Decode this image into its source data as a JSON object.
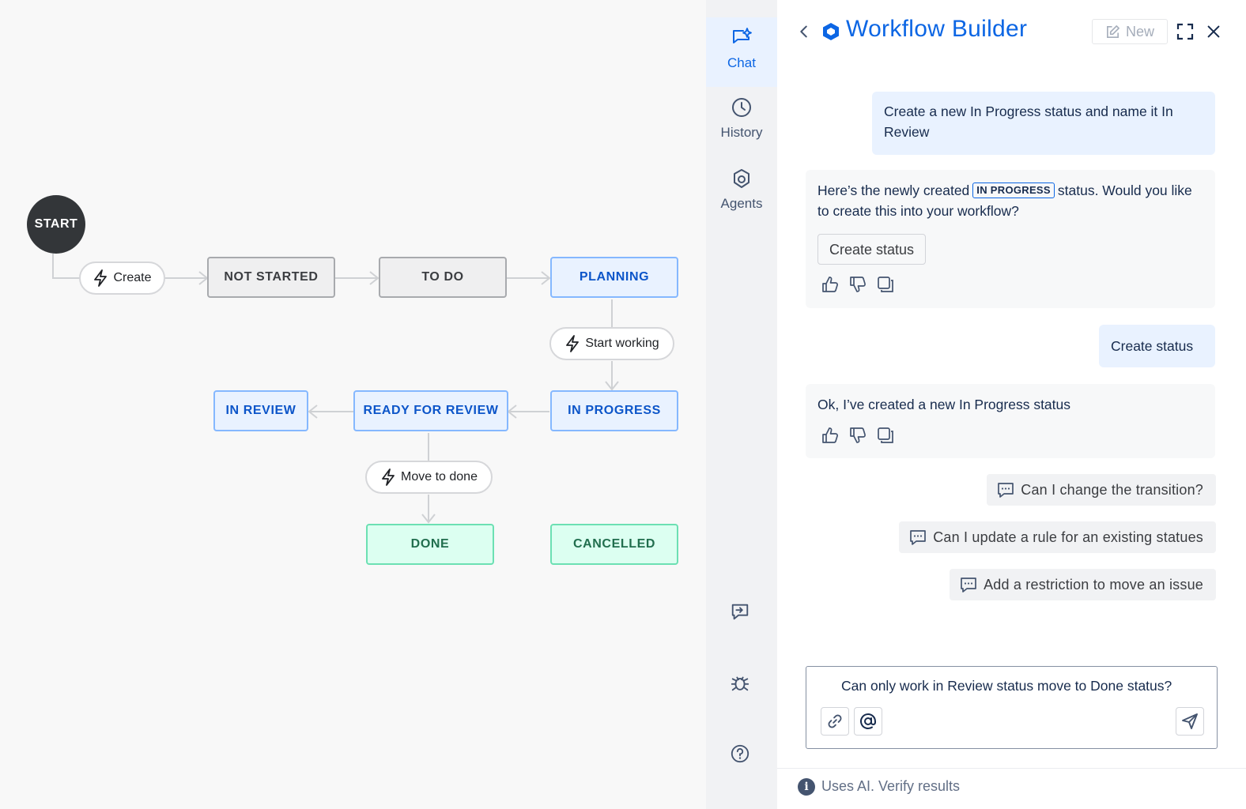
{
  "canvas": {
    "start_label": "START",
    "statuses": {
      "not_started": "NOT STARTED",
      "to_do": "TO DO",
      "planning": "PLANNING",
      "in_progress": "IN PROGRESS",
      "ready_for_review": "READY FOR REVIEW",
      "in_review": "IN REVIEW",
      "done": "DONE",
      "cancelled": "CANCELLED"
    },
    "transitions": {
      "create": "Create",
      "start_working": "Start working",
      "move_to_done": "Move to done"
    }
  },
  "rail": {
    "chat": "Chat",
    "history": "History",
    "agents": "Agents"
  },
  "header": {
    "title": "Workflow Builder",
    "new_label": "New"
  },
  "messages": {
    "user_1": "Create a new In Progress status and name it In Review",
    "ai_1_before": "Here’s the newly created",
    "ai_1_lozenge": "IN PROGRESS",
    "ai_1_after": "status. Would you like to create this into your workflow?",
    "ai_1_action": "Create status",
    "user_2": "Create status",
    "ai_2": "Ok, I’ve created a new In Progress status"
  },
  "suggestions": [
    "Can I change the transition?",
    "Can I update a rule for an existing statues",
    "Add a restriction to move an issue"
  ],
  "composer": {
    "value": "Can only work in Review status move to Done status?"
  },
  "footer": {
    "info_glyph": "i",
    "text": "Uses AI. Verify results"
  },
  "colors": {
    "accent": "#0c66e4",
    "status_blue_bg": "#e9f2ff",
    "status_green_bg": "#dcfff1",
    "start_node": "#333639"
  }
}
